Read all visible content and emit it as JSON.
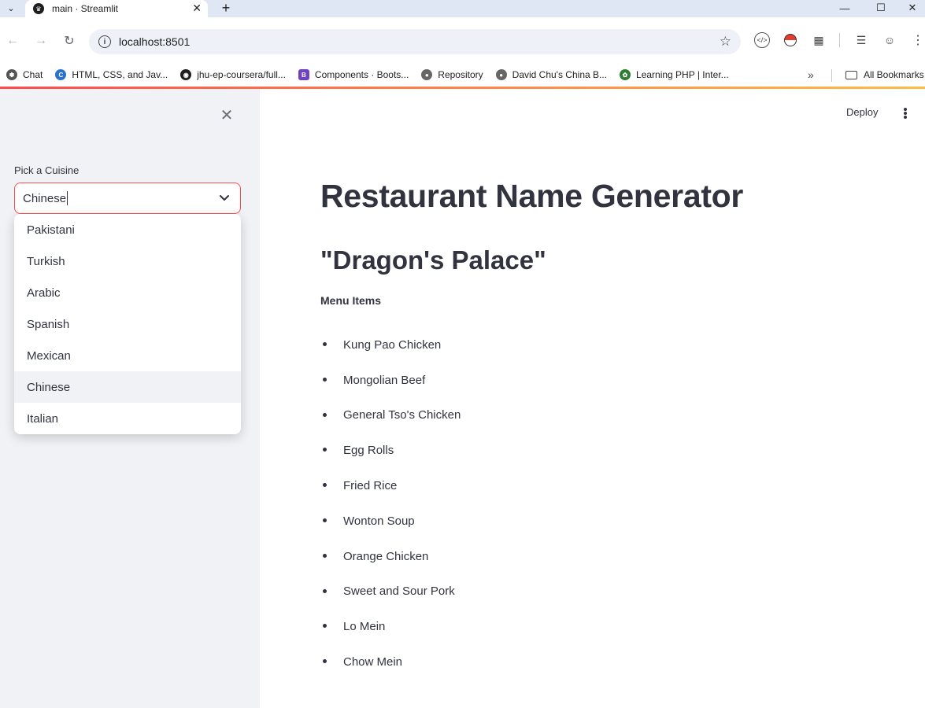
{
  "browser": {
    "tab_title": "main · Streamlit",
    "url": "localhost:8501",
    "bookmarks": [
      {
        "label": "Chat",
        "icon": "openai-icon"
      },
      {
        "label": "HTML, CSS, and Jav...",
        "icon": "coursera-icon"
      },
      {
        "label": "jhu-ep-coursera/full...",
        "icon": "github-icon"
      },
      {
        "label": "Components · Boots...",
        "icon": "bootstrap-icon"
      },
      {
        "label": "Repository",
        "icon": "globe-icon"
      },
      {
        "label": "David Chu's China B...",
        "icon": "globe-icon"
      },
      {
        "label": "Learning PHP | Inter...",
        "icon": "leaf-icon"
      }
    ],
    "all_bookmarks_label": "All Bookmarks"
  },
  "app": {
    "deploy_label": "Deploy",
    "sidebar": {
      "select_label": "Pick a Cuisine",
      "select_value": "Chinese",
      "options": [
        "Pakistani",
        "Turkish",
        "Arabic",
        "Spanish",
        "Mexican",
        "Chinese",
        "Italian"
      ],
      "highlighted_option": "Chinese"
    },
    "main": {
      "title": "Restaurant Name Generator",
      "restaurant_name": "\"Dragon's Palace\"",
      "menu_label": "Menu Items",
      "menu_items": [
        "Kung Pao Chicken",
        "Mongolian Beef",
        "General Tso's Chicken",
        "Egg Rolls",
        "Fried Rice",
        "Wonton Soup",
        "Orange Chicken",
        "Sweet and Sour Pork",
        "Lo Mein",
        "Chow Mein"
      ]
    }
  },
  "colors": {
    "accent": "#ff4b4b",
    "sidebar_bg": "#f0f2f6",
    "text": "#31333f"
  }
}
